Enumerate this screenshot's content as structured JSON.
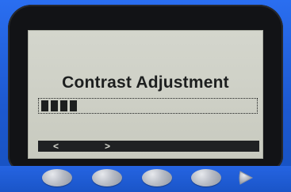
{
  "display": {
    "title": "Contrast Adjustment",
    "contrast_level_blocks": 4,
    "nav_left_label": "<",
    "nav_right_label": ">"
  },
  "softkeys": [
    {
      "name": "softkey-1",
      "icon": "oval-button"
    },
    {
      "name": "softkey-2",
      "icon": "oval-button"
    },
    {
      "name": "softkey-3",
      "icon": "oval-button"
    },
    {
      "name": "softkey-4",
      "icon": "oval-button"
    },
    {
      "name": "softkey-5",
      "icon": "play-arrow-icon"
    }
  ],
  "colors": {
    "device_body": "#1f5fd8",
    "bezel": "#121316",
    "screen_bg": "#d4d6cd",
    "screen_text": "#1d1f1f"
  }
}
